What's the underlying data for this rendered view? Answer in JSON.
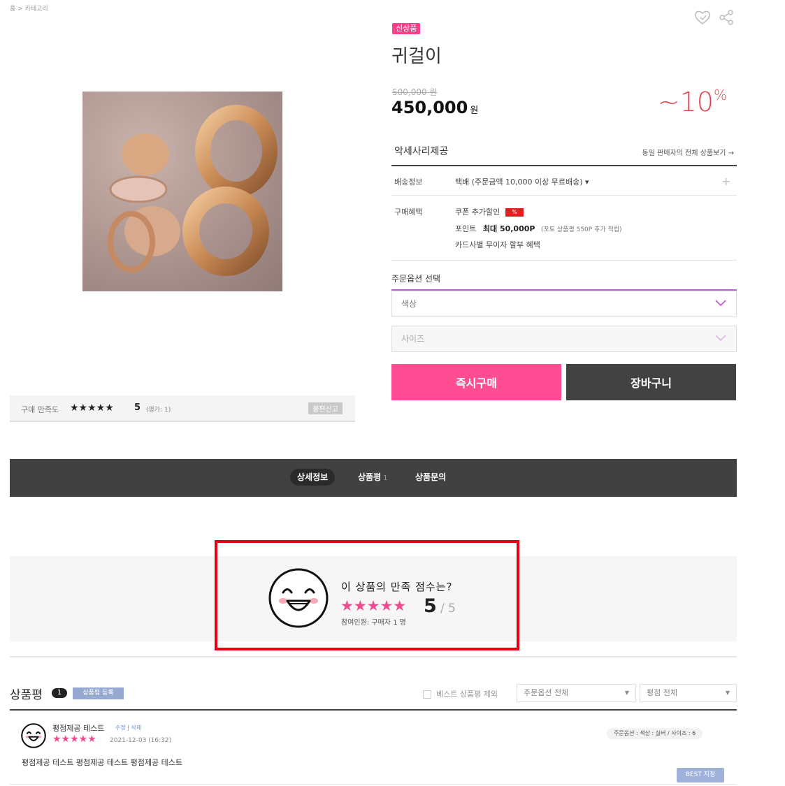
{
  "breadcrumb": "홈 > 카테고리",
  "product": {
    "badge": "신상품",
    "title": "귀걸이",
    "original_price": "500,000 원",
    "sale_price": "450,000",
    "currency": "원",
    "discount": "~10",
    "discount_unit": "%"
  },
  "seller": {
    "name": "악세사리제공",
    "link": "동일 판매자의 전체 상품보기 →"
  },
  "delivery": {
    "label": "배송정보",
    "text": "택배 (주문금액 10,000 이상 무료배송) ▾"
  },
  "benefits": {
    "label": "구매혜택",
    "coupon": "쿠폰 추가할인",
    "coupon_tag": "%",
    "point_label": "포인트",
    "point_value": "최대 50,000P",
    "point_note": "(포토 상품평 550P 추가 적립)",
    "card": "카드사별 무이자 할부 혜택"
  },
  "options": {
    "label": "주문옵션 선택",
    "color_placeholder": "색상",
    "size_placeholder": "사이즈"
  },
  "buttons": {
    "buy": "즉시구매",
    "cart": "장바구니"
  },
  "satisfaction_mini": {
    "label": "구매 만족도",
    "stars": "★★★★★",
    "score": "5",
    "count": "(평가: 1)",
    "report": "불편신고"
  },
  "tabs": [
    {
      "label": "상세정보"
    },
    {
      "label": "상품평",
      "count": "1"
    },
    {
      "label": "상품문의"
    }
  ],
  "summary": {
    "question": "이 상품의 만족 점수는?",
    "stars": "★★★★★",
    "score": "5",
    "total": "/ 5",
    "participants": "참여인원: 구매자 1 명"
  },
  "reviews": {
    "heading": "상품평",
    "count": "1",
    "write_button": "상품평 등록",
    "filter_best": "베스트 상품평 제외",
    "filter_option": "주문옵션 전체",
    "filter_rating": "평점 전체",
    "items": [
      {
        "author": "평점제공 테스트",
        "tags": "수정 | 삭제",
        "stars": "★★★★★",
        "date": "2021-12-03 (16:32)",
        "option": "주문옵션 : 색상 : 실버 / 사이즈 : 6",
        "body": "평점제공 테스트 평점제공 테스트 평점제공 테스트",
        "best_button": "BEST 지정"
      }
    ]
  },
  "colors": {
    "accent_pink": "#ff4d94",
    "dark": "#424242",
    "discount_red": "#e8404a",
    "highlight_red": "#e60012"
  }
}
